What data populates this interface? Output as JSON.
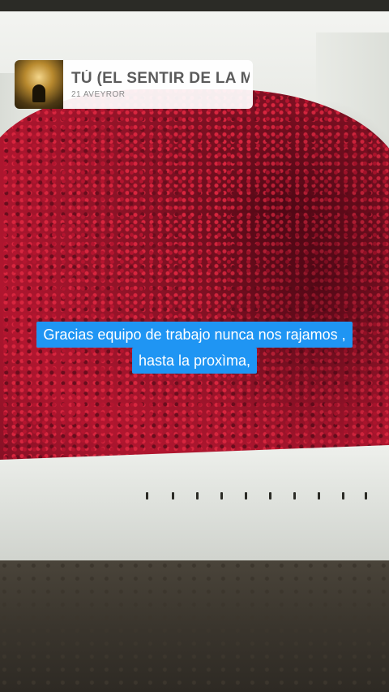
{
  "music_sticker": {
    "icon": "album-art-icon",
    "title": "TÚ (EL SENTIR DE LA MÚSICA",
    "artist": "21 AVEYROR"
  },
  "caption": {
    "line1": "Gracias equipo de trabajo nunca nos rajamos ,",
    "line2": "hasta  la proxìma,",
    "background_color": "#1f95f3",
    "text_color": "#ffffff"
  }
}
